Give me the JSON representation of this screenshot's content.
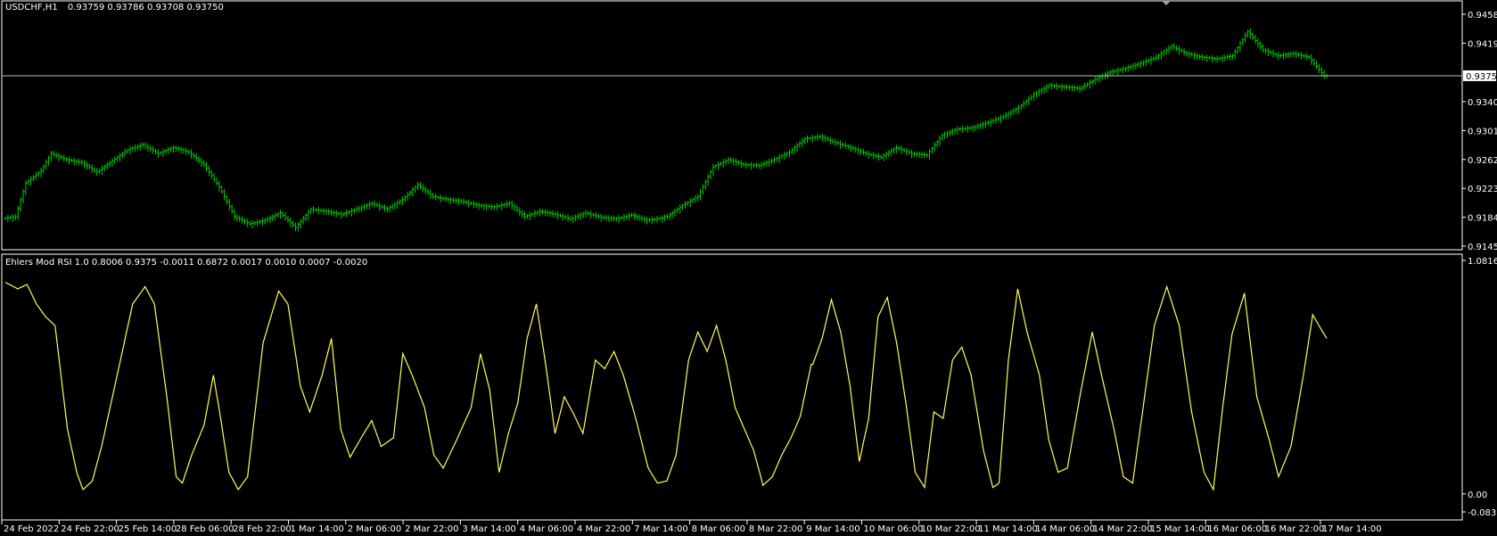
{
  "header": {
    "symbol_timeframe": "USDCHF,H1",
    "ohlc": "0.93759 0.93786 0.93708 0.93750"
  },
  "indicator": {
    "label": "Ehlers Mod RSI 1.0 0.8006 0.9375 -0.0011 0.6872 0.0017 0.0010 0.0007 -0.0020"
  },
  "colors": {
    "background": "#000000",
    "candles": "#00d000",
    "rsi_line": "#ffff5a",
    "price_line": "#b8c4b8",
    "axis_text": "#ffffff"
  },
  "chart_data": [
    {
      "type": "bar",
      "name": "price-panel",
      "ylim": [
        0.9145,
        0.9458
      ],
      "y_ticks": [
        "0.94580",
        "0.94190",
        "0.93400",
        "0.93010",
        "0.92620",
        "0.92230",
        "0.91840",
        "0.91450"
      ],
      "current_price": 0.9375,
      "current_price_label": "0.93750",
      "x_count": 260,
      "close_keyframes": [
        [
          0,
          0.9183
        ],
        [
          4,
          0.9185
        ],
        [
          8,
          0.923
        ],
        [
          14,
          0.9247
        ],
        [
          18,
          0.927
        ],
        [
          24,
          0.9262
        ],
        [
          30,
          0.9258
        ],
        [
          36,
          0.9245
        ],
        [
          42,
          0.926
        ],
        [
          48,
          0.9275
        ],
        [
          54,
          0.9282
        ],
        [
          60,
          0.927
        ],
        [
          66,
          0.9278
        ],
        [
          72,
          0.9272
        ],
        [
          78,
          0.9255
        ],
        [
          84,
          0.9225
        ],
        [
          90,
          0.9185
        ],
        [
          96,
          0.9175
        ],
        [
          102,
          0.918
        ],
        [
          108,
          0.919
        ],
        [
          114,
          0.917
        ],
        [
          120,
          0.9195
        ],
        [
          126,
          0.9192
        ],
        [
          132,
          0.9188
        ],
        [
          138,
          0.9195
        ],
        [
          144,
          0.9203
        ],
        [
          150,
          0.9195
        ],
        [
          156,
          0.9208
        ],
        [
          162,
          0.9228
        ],
        [
          168,
          0.9212
        ],
        [
          174,
          0.9208
        ],
        [
          180,
          0.9205
        ],
        [
          186,
          0.92
        ],
        [
          192,
          0.9198
        ],
        [
          198,
          0.9203
        ],
        [
          204,
          0.9185
        ],
        [
          210,
          0.9192
        ],
        [
          216,
          0.9188
        ],
        [
          222,
          0.9182
        ],
        [
          228,
          0.919
        ],
        [
          234,
          0.9184
        ],
        [
          240,
          0.9182
        ],
        [
          246,
          0.9187
        ],
        [
          252,
          0.918
        ],
        [
          258,
          0.9183
        ],
        [
          259,
          0.9185
        ]
      ],
      "close_keyframes_part2": [
        [
          0,
          0.9185
        ],
        [
          6,
          0.92
        ],
        [
          12,
          0.9212
        ],
        [
          18,
          0.9252
        ],
        [
          24,
          0.9262
        ],
        [
          30,
          0.9255
        ],
        [
          36,
          0.9254
        ],
        [
          42,
          0.9262
        ],
        [
          48,
          0.9272
        ],
        [
          54,
          0.929
        ],
        [
          60,
          0.9293
        ],
        [
          66,
          0.9285
        ],
        [
          72,
          0.9278
        ],
        [
          78,
          0.927
        ],
        [
          84,
          0.9265
        ],
        [
          90,
          0.9278
        ],
        [
          96,
          0.927
        ],
        [
          102,
          0.9268
        ],
        [
          108,
          0.9295
        ],
        [
          114,
          0.9303
        ],
        [
          120,
          0.9305
        ],
        [
          126,
          0.9312
        ],
        [
          132,
          0.932
        ],
        [
          138,
          0.9332
        ],
        [
          144,
          0.935
        ],
        [
          150,
          0.9362
        ],
        [
          156,
          0.936
        ],
        [
          162,
          0.9358
        ],
        [
          168,
          0.937
        ],
        [
          174,
          0.938
        ],
        [
          180,
          0.9385
        ],
        [
          186,
          0.9392
        ],
        [
          192,
          0.94
        ],
        [
          198,
          0.9415
        ],
        [
          204,
          0.9405
        ],
        [
          210,
          0.94
        ],
        [
          216,
          0.9398
        ],
        [
          222,
          0.9402
        ],
        [
          228,
          0.9435
        ],
        [
          234,
          0.941
        ],
        [
          240,
          0.9402
        ],
        [
          246,
          0.9405
        ],
        [
          252,
          0.94
        ],
        [
          258,
          0.9375
        ],
        [
          259,
          0.9375
        ]
      ]
    },
    {
      "type": "line",
      "name": "indicator-panel",
      "ylim": [
        -0.0833,
        1.0816
      ],
      "y_ticks": [
        "1.0816",
        "0.00",
        "-0.0833"
      ],
      "x_count": 520,
      "rsi_keyframes": [
        [
          0,
          0.98
        ],
        [
          8,
          0.95
        ],
        [
          14,
          0.97
        ],
        [
          20,
          0.88
        ],
        [
          26,
          0.82
        ],
        [
          32,
          0.78
        ],
        [
          40,
          0.3
        ],
        [
          46,
          0.1
        ],
        [
          50,
          0.02
        ],
        [
          56,
          0.06
        ],
        [
          62,
          0.22
        ],
        [
          72,
          0.55
        ],
        [
          82,
          0.88
        ],
        [
          90,
          0.96
        ],
        [
          96,
          0.88
        ],
        [
          104,
          0.45
        ],
        [
          110,
          0.08
        ],
        [
          114,
          0.05
        ],
        [
          120,
          0.18
        ],
        [
          128,
          0.32
        ],
        [
          134,
          0.55
        ],
        [
          138,
          0.38
        ],
        [
          144,
          0.1
        ],
        [
          150,
          0.02
        ],
        [
          156,
          0.08
        ],
        [
          166,
          0.7
        ],
        [
          176,
          0.94
        ],
        [
          182,
          0.88
        ],
        [
          190,
          0.5
        ],
        [
          196,
          0.38
        ],
        [
          204,
          0.55
        ],
        [
          210,
          0.72
        ],
        [
          216,
          0.3
        ],
        [
          222,
          0.17
        ],
        [
          230,
          0.27
        ],
        [
          236,
          0.34
        ],
        [
          242,
          0.22
        ],
        [
          250,
          0.26
        ],
        [
          256,
          0.65
        ],
        [
          262,
          0.55
        ],
        [
          270,
          0.4
        ],
        [
          276,
          0.18
        ],
        [
          282,
          0.12
        ],
        [
          290,
          0.24
        ],
        [
          300,
          0.4
        ],
        [
          306,
          0.65
        ],
        [
          312,
          0.48
        ],
        [
          318,
          0.1
        ],
        [
          324,
          0.28
        ],
        [
          330,
          0.42
        ],
        [
          336,
          0.72
        ],
        [
          342,
          0.88
        ],
        [
          348,
          0.6
        ],
        [
          354,
          0.28
        ],
        [
          360,
          0.45
        ],
        [
          366,
          0.37
        ],
        [
          372,
          0.28
        ],
        [
          380,
          0.62
        ],
        [
          386,
          0.58
        ],
        [
          392,
          0.66
        ],
        [
          398,
          0.55
        ],
        [
          406,
          0.35
        ],
        [
          414,
          0.12
        ],
        [
          420,
          0.05
        ],
        [
          426,
          0.06
        ],
        [
          432,
          0.18
        ],
        [
          440,
          0.62
        ],
        [
          446,
          0.75
        ],
        [
          452,
          0.66
        ],
        [
          458,
          0.78
        ],
        [
          464,
          0.62
        ],
        [
          470,
          0.4
        ],
        [
          476,
          0.3
        ],
        [
          482,
          0.2
        ],
        [
          488,
          0.04
        ],
        [
          494,
          0.08
        ],
        [
          500,
          0.18
        ],
        [
          506,
          0.26
        ],
        [
          512,
          0.36
        ],
        [
          519,
          0.6
        ]
      ],
      "rsi_keyframes_part2": [
        [
          0,
          0.6
        ],
        [
          6,
          0.72
        ],
        [
          12,
          0.9
        ],
        [
          18,
          0.75
        ],
        [
          24,
          0.5
        ],
        [
          30,
          0.15
        ],
        [
          36,
          0.35
        ],
        [
          42,
          0.82
        ],
        [
          48,
          0.91
        ],
        [
          54,
          0.7
        ],
        [
          60,
          0.42
        ],
        [
          66,
          0.1
        ],
        [
          72,
          0.03
        ],
        [
          78,
          0.38
        ],
        [
          84,
          0.35
        ],
        [
          90,
          0.62
        ],
        [
          96,
          0.68
        ],
        [
          102,
          0.55
        ],
        [
          110,
          0.2
        ],
        [
          116,
          0.03
        ],
        [
          120,
          0.05
        ],
        [
          126,
          0.62
        ],
        [
          132,
          0.95
        ],
        [
          138,
          0.75
        ],
        [
          146,
          0.55
        ],
        [
          152,
          0.25
        ],
        [
          158,
          0.1
        ],
        [
          164,
          0.12
        ],
        [
          172,
          0.45
        ],
        [
          180,
          0.75
        ],
        [
          186,
          0.55
        ],
        [
          194,
          0.3
        ],
        [
          200,
          0.08
        ],
        [
          206,
          0.05
        ],
        [
          212,
          0.36
        ],
        [
          220,
          0.78
        ],
        [
          228,
          0.96
        ],
        [
          236,
          0.78
        ],
        [
          244,
          0.38
        ],
        [
          252,
          0.1
        ],
        [
          258,
          0.02
        ],
        [
          264,
          0.4
        ],
        [
          270,
          0.74
        ],
        [
          278,
          0.93
        ],
        [
          286,
          0.45
        ],
        [
          294,
          0.25
        ],
        [
          300,
          0.08
        ],
        [
          308,
          0.22
        ],
        [
          316,
          0.55
        ],
        [
          322,
          0.83
        ],
        [
          326,
          0.78
        ],
        [
          331,
          0.72
        ]
      ]
    }
  ],
  "time_axis": {
    "labels": [
      "24 Feb 2022",
      "24 Feb 22:00",
      "25 Feb 14:00",
      "28 Feb 06:00",
      "28 Feb 22:00",
      "1 Mar 14:00",
      "2 Mar 06:00",
      "2 Mar 22:00",
      "3 Mar 14:00",
      "4 Mar 06:00",
      "4 Mar 22:00",
      "7 Mar 14:00",
      "8 Mar 06:00",
      "8 Mar 22:00",
      "9 Mar 14:00",
      "10 Mar 06:00",
      "10 Mar 22:00",
      "11 Mar 14:00",
      "14 Mar 06:00",
      "14 Mar 22:00",
      "15 Mar 14:00",
      "16 Mar 06:00",
      "16 Mar 22:00",
      "17 Mar 14:00"
    ]
  }
}
